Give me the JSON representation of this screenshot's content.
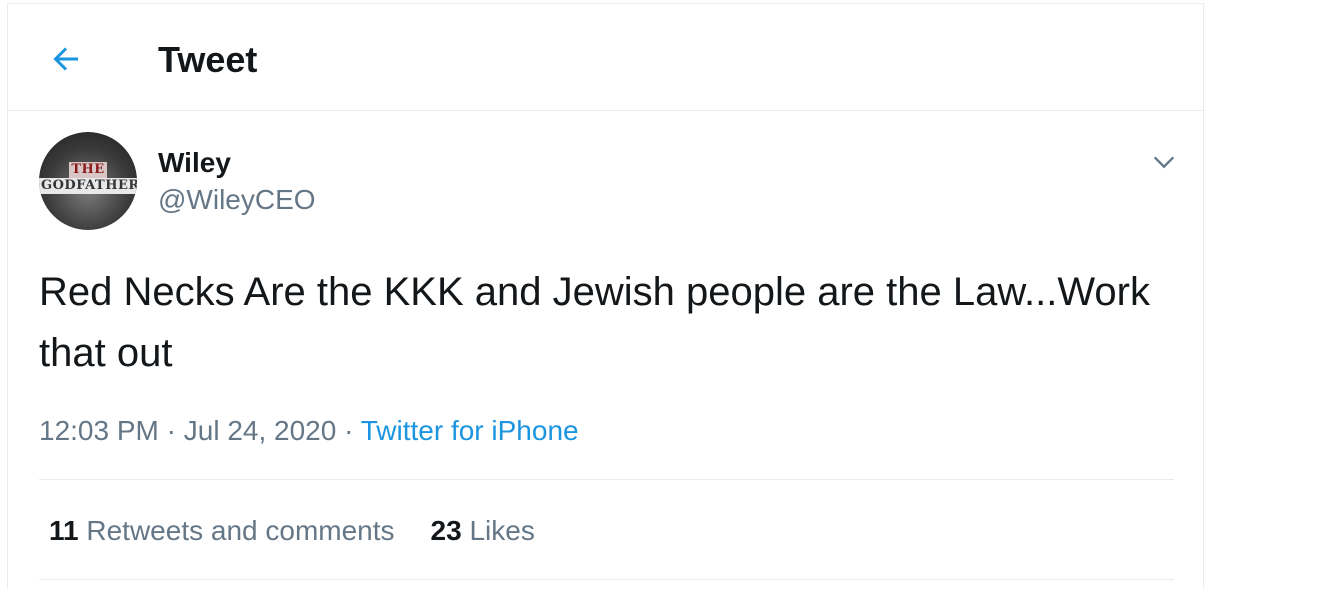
{
  "header": {
    "back_icon": "arrow-left-icon",
    "title": "Tweet"
  },
  "tweet": {
    "author": {
      "display_name": "Wiley",
      "handle": "@WileyCEO",
      "avatar_text_top": "THE",
      "avatar_text_bottom": "GODFATHER"
    },
    "menu_icon": "chevron-down-icon",
    "text": "Red Necks Are the KKK and Jewish people are the Law...Work that out",
    "time": "12:03 PM",
    "separator": "·",
    "date": "Jul 24, 2020",
    "source": "Twitter for iPhone",
    "stats": {
      "retweets_count": "11",
      "retweets_label": "Retweets and comments",
      "likes_count": "23",
      "likes_label": "Likes"
    }
  },
  "colors": {
    "accent": "#1b95e0",
    "text_primary": "#14171a",
    "text_secondary": "#657786",
    "border": "#e6ecf0"
  }
}
